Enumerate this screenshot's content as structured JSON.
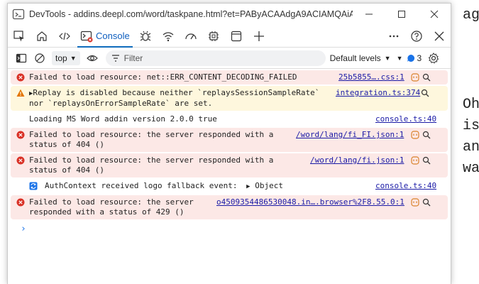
{
  "window": {
    "title": "DevTools - addins.deepl.com/word/taskpane.html?et=PAByACAAdgA9ACIAMQAiAD4..."
  },
  "tabs": {
    "active_label": "Console"
  },
  "toolbar": {
    "context": "top",
    "filter_placeholder": "Filter",
    "levels_label": "Default levels",
    "issues_count": "3"
  },
  "messages": [
    {
      "level": "error",
      "text": "Failed to load resource: net::ERR_CONTENT_DECODING_FAILED",
      "source": "25b5855….css:1"
    },
    {
      "level": "warn",
      "text": "Replay is disabled because neither `replaysSessionSampleRate`\nnor `replaysOnErrorSampleRate` are set.",
      "source": "integration.ts:374"
    },
    {
      "level": "log",
      "text": "Loading MS Word addin version 2.0.0 true",
      "source": "console.ts:40"
    },
    {
      "level": "error",
      "text": "Failed to load resource: the server responded with a\nstatus of 404 ()",
      "source": "/word/lang/fi_FI.json:1"
    },
    {
      "level": "error",
      "text": "Failed to load resource: the server responded with a\nstatus of 404 ()",
      "source": "/word/lang/fi.json:1"
    },
    {
      "level": "info",
      "text": "AuthContext received logo fallback event:",
      "object_label": "Object",
      "source": "console.ts:40"
    },
    {
      "level": "error",
      "text": "Failed to load resource: the server\nresponded with a status of 429 ()",
      "source": "o4509354486530048.in….browser%2F8.55.0:1"
    }
  ],
  "prompt": "›",
  "background_page": {
    "lines": [
      "ag",
      "Oh",
      "is",
      "an",
      "wa"
    ]
  }
}
